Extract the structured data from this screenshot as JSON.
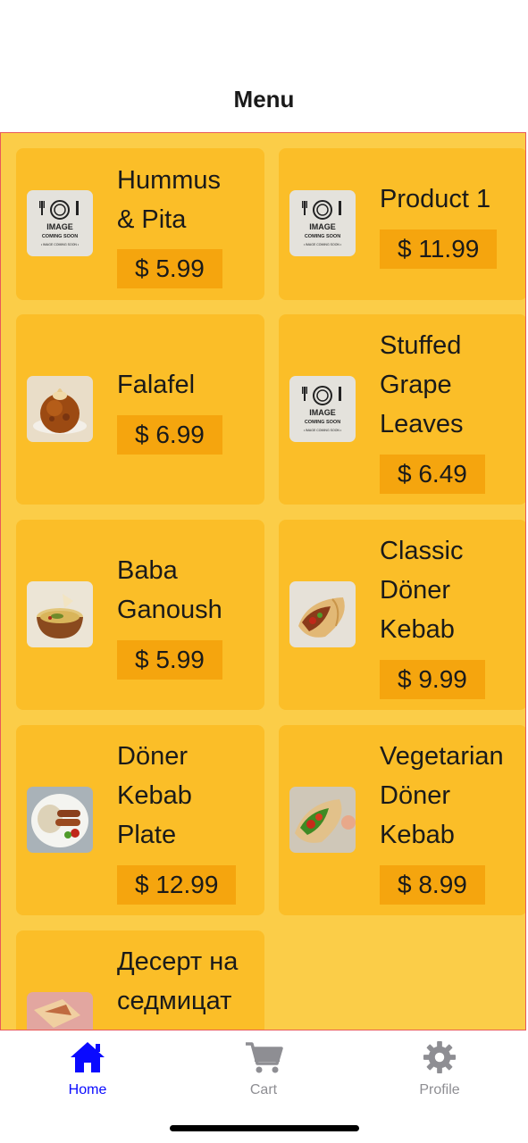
{
  "header": {
    "title": "Menu"
  },
  "products": [
    {
      "name_lines": [
        "Hummus",
        "& Pita"
      ],
      "price": "$ 5.99",
      "image": "image-coming-soon"
    },
    {
      "name_lines": [
        "Product 1"
      ],
      "price": "$ 11.99",
      "image": "image-coming-soon"
    },
    {
      "name_lines": [
        "Falafel"
      ],
      "price": "$ 6.99",
      "image": "falafel-photo"
    },
    {
      "name_lines": [
        "Stuffed",
        "Grape",
        "Leaves"
      ],
      "price": "$ 6.49",
      "image": "image-coming-soon"
    },
    {
      "name_lines": [
        "Baba",
        "Ganoush"
      ],
      "price": "$ 5.99",
      "image": "baba-ganoush-photo"
    },
    {
      "name_lines": [
        "Classic",
        "Döner",
        "Kebab"
      ],
      "price": "$ 9.99",
      "image": "doner-wrap-photo"
    },
    {
      "name_lines": [
        "Döner",
        "Kebab",
        "Plate"
      ],
      "price": "$ 12.99",
      "image": "kebab-plate-photo"
    },
    {
      "name_lines": [
        "Vegetarian",
        "Döner",
        "Kebab"
      ],
      "price": "$ 8.99",
      "image": "veggie-wrap-photo"
    },
    {
      "name_lines": [
        "Десерт на",
        "седмицат"
      ],
      "price": "",
      "image": "dessert-photo"
    }
  ],
  "placeholder_image": {
    "line1": "IMAGE",
    "line2": "COMING SOON",
    "line3": "• IMAGE COMING SOON •"
  },
  "tabbar": {
    "items": [
      {
        "label": "Home",
        "icon": "home-icon",
        "active": true
      },
      {
        "label": "Cart",
        "icon": "cart-icon",
        "active": false
      },
      {
        "label": "Profile",
        "icon": "gear-icon",
        "active": false
      }
    ]
  },
  "colors": {
    "background": "#fbcd48",
    "card": "#fbbe28",
    "price_chip": "#f5a50e",
    "tab_active": "#0a0aff",
    "tab_inactive": "#8e8e93"
  }
}
